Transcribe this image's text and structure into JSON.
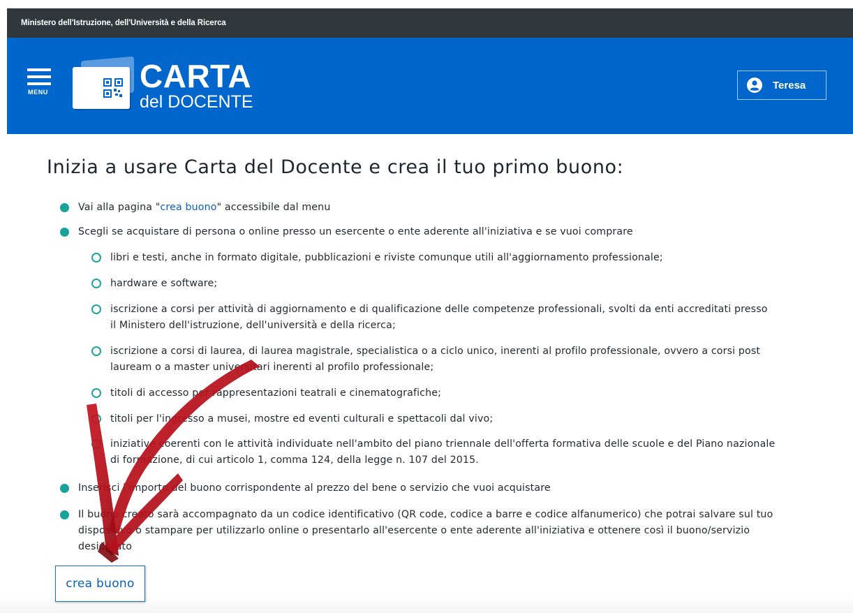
{
  "topbar": {
    "ministry": "Ministero dell'Istruzione, dell'Università e della Ricerca"
  },
  "header": {
    "menu_label": "MENU",
    "logo_title": "CARTA",
    "logo_subtitle": "del DOCENTE",
    "user_name": "Teresa"
  },
  "main": {
    "title": "Inizia a usare Carta del Docente e crea il tuo primo buono:",
    "steps": [
      {
        "before": "Vai alla pagina \"",
        "link": "crea buono",
        "after": "\" accessibile dal menu"
      },
      {
        "text": "Scegli se acquistare di persona o online presso un esercente o ente aderente all'iniziativa e se vuoi comprare"
      },
      {
        "text": "Inserisci l'importo del buono corrispondente al prezzo del bene o servizio che vuoi acquistare"
      },
      {
        "text": "Il buono creato sarà accompagnato da un codice identificativo (QR code, codice a barre e codice alfanumerico) che potrai salvare sul tuo dispositivo o stampare per utilizzarlo online o presentarlo all'esercente o ente aderente all'iniziativa e ottenere così il buono/servizio desiderato"
      }
    ],
    "sub_items": [
      "libri e testi, anche in formato digitale, pubblicazioni e riviste comunque utili all'aggiornamento professionale;",
      "hardware e software;",
      "iscrizione a corsi per attività di aggiornamento e di qualificazione delle competenze professionali, svolti da enti accreditati presso il Ministero dell'istruzione, dell'università e della ricerca;",
      "iscrizione a corsi di laurea, di laurea magistrale, specialistica o a ciclo unico, inerenti al profilo professionale, ovvero a corsi post lauream o a master universitari inerenti al profilo professionale;",
      "titoli di accesso per rappresentazioni teatrali e cinematografiche;",
      "titoli per l'ingresso a musei, mostre ed eventi culturali e spettacoli dal vivo;",
      "iniziative coerenti con le attività individuate nell'ambito del piano triennale dell'offerta formativa delle scuole e del Piano nazionale di formazione, di cui articolo 1, comma 124, della legge n. 107 del 2015."
    ],
    "cta_label": "crea buono"
  },
  "colors": {
    "topbar": "#30373d",
    "header": "#0066cc",
    "bullet": "#17a39a",
    "link": "#0a5fba",
    "arrow": "#b3121d"
  },
  "icons": {
    "menu": "hamburger-icon",
    "logo": "card-qr-icon",
    "user": "user-circle-icon",
    "bullet": "filled-dot",
    "sub_bullet": "open-circle",
    "overlay": "red-arrow-annotation"
  }
}
